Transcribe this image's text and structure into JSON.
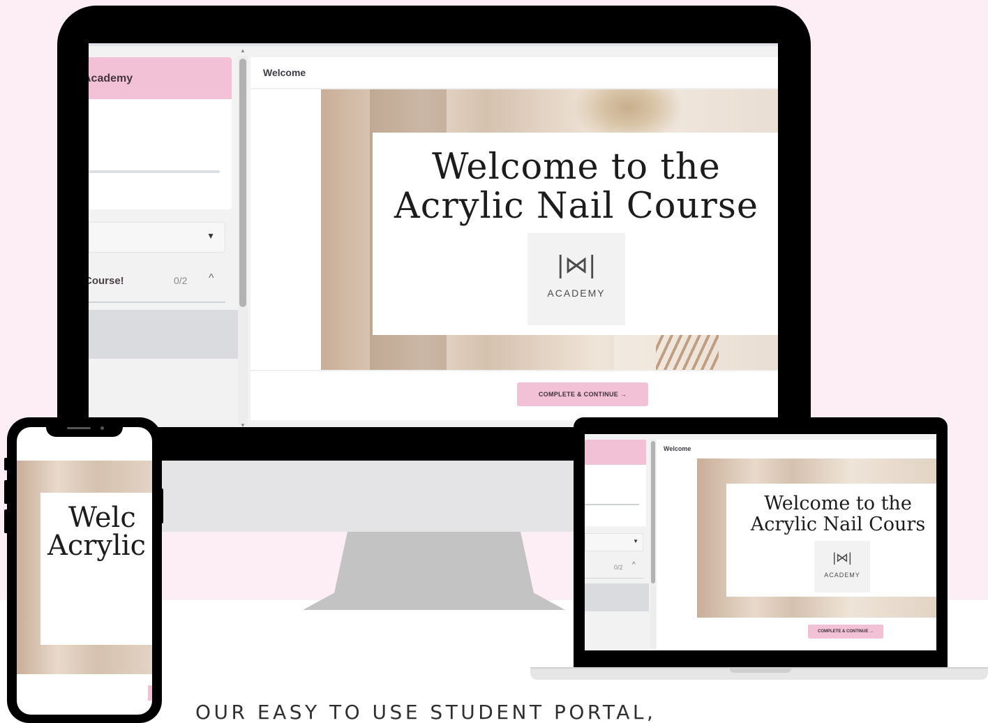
{
  "desktop": {
    "sidebar": {
      "course_title": "Academy",
      "chapter_label": "Course!",
      "chapter_count": "0/2"
    },
    "main": {
      "lesson_title": "Welcome",
      "hero_heading_line1": "Welcome to the",
      "hero_heading_line2": "Acrylic Nail Course",
      "logo_wordmark": "ACADEMY",
      "cta_label": "COMPLETE & CONTINUE →"
    }
  },
  "laptop": {
    "sidebar": {
      "chapter_count": "0/2"
    },
    "main": {
      "lesson_title": "Welcome",
      "hero_heading_line1": "Welcome to the",
      "hero_heading_line2": "Acrylic Nail Cours",
      "logo_wordmark": "ACADEMY",
      "cta_label": "COMPLETE & CONTINUE →"
    }
  },
  "phone": {
    "hero_heading_line1": "Welc",
    "hero_heading_line2": "Acrylic"
  },
  "tagline": "OUR EASY TO USE STUDENT PORTAL,",
  "icons": {
    "dropdown": "caret-down-icon",
    "collapse": "chevron-up-icon",
    "logo": "mn-monogram-logo"
  },
  "colors": {
    "background_pink": "#fdeef6",
    "accent_pink": "#f3c1d6",
    "device_black": "#000000"
  }
}
